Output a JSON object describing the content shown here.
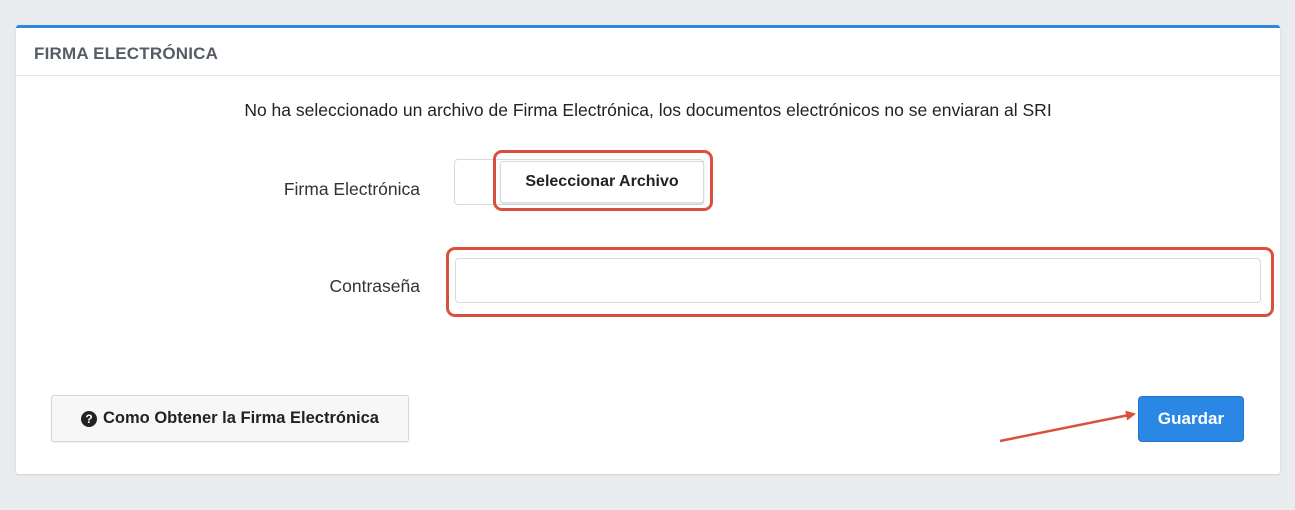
{
  "card": {
    "title": "FIRMA ELECTRÓNICA",
    "notice": "No ha seleccionado un archivo de Firma Electrónica, los documentos electrónicos no se enviaran al SRI"
  },
  "form": {
    "signature_label": "Firma Electrónica",
    "select_file_label": "Seleccionar Archivo",
    "password_label": "Contraseña",
    "password_value": ""
  },
  "footer": {
    "help_icon": "question-circle-icon",
    "help_button_label": "Como Obtener la Firma Electrónica",
    "save_button_label": "Guardar"
  },
  "annotations": {
    "highlight_color": "#d9503f"
  },
  "colors": {
    "accent": "#2a87e3",
    "background": "#e9ecef"
  }
}
